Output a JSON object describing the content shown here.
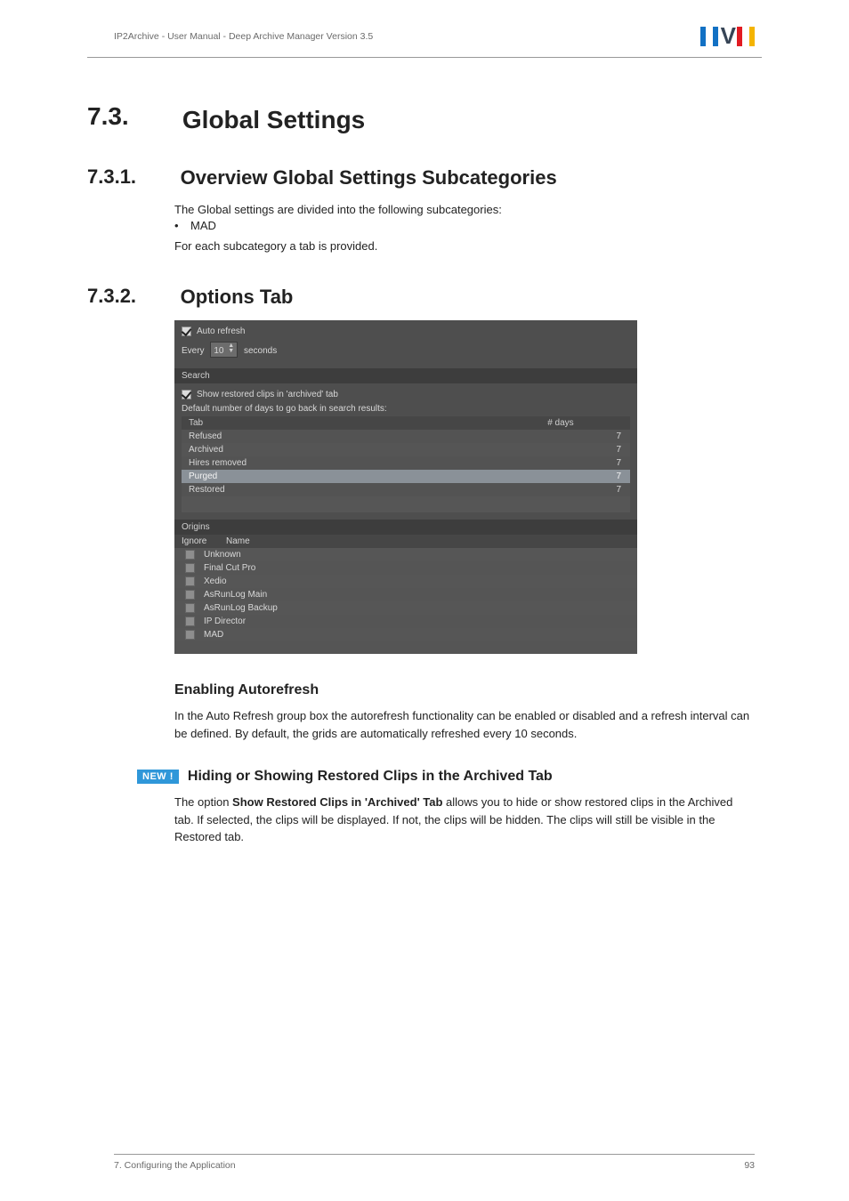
{
  "header": {
    "breadcrumb": "IP2Archive - User Manual - Deep Archive Manager Version 3.5"
  },
  "sections": {
    "s73": {
      "num": "7.3.",
      "title": "Global Settings"
    },
    "s731": {
      "num": "7.3.1.",
      "title": "Overview Global Settings Subcategories",
      "intro": "The Global settings are divided into the following subcategories:",
      "bullet1": "MAD",
      "outro": "For each subcategory a tab is provided."
    },
    "s732": {
      "num": "7.3.2.",
      "title": "Options Tab"
    }
  },
  "panel": {
    "auto_refresh_label": "Auto refresh",
    "every_prefix": "Every",
    "every_value": "10",
    "every_suffix": "seconds",
    "search_header": "Search",
    "show_restored_label": "Show restored clips in 'archived' tab",
    "default_days_label": "Default number of days to go back in search results:",
    "table": {
      "col_tab": "Tab",
      "col_days": "# days",
      "rows": [
        {
          "tab": "Refused",
          "days": "7"
        },
        {
          "tab": "Archived",
          "days": "7"
        },
        {
          "tab": "Hires removed",
          "days": "7"
        },
        {
          "tab": "Purged",
          "days": "7"
        },
        {
          "tab": "Restored",
          "days": "7"
        }
      ]
    },
    "origins_header": "Origins",
    "origins_cols": {
      "ignore": "Ignore",
      "name": "Name"
    },
    "origins": [
      "Unknown",
      "Final Cut Pro",
      "Xedio",
      "AsRunLog Main",
      "AsRunLog Backup",
      "IP Director",
      "MAD"
    ]
  },
  "subsections": {
    "autorefresh": {
      "title": "Enabling Autorefresh",
      "body": "In the Auto Refresh group box the autorefresh functionality can be enabled or disabled and a refresh interval can be defined. By default, the grids are automatically refreshed every 10 seconds."
    },
    "hiding": {
      "badge": "NEW !",
      "title": "Hiding or Showing Restored Clips in the Archived Tab",
      "body_pre": "The option ",
      "body_bold": "Show Restored Clips in 'Archived' Tab",
      "body_post": " allows you to hide or show restored clips in the Archived tab. If selected, the clips will be displayed. If not, the clips will be hidden. The clips will still be visible in the Restored tab."
    }
  },
  "footer": {
    "left": "7. Configuring the Application",
    "right": "93"
  }
}
